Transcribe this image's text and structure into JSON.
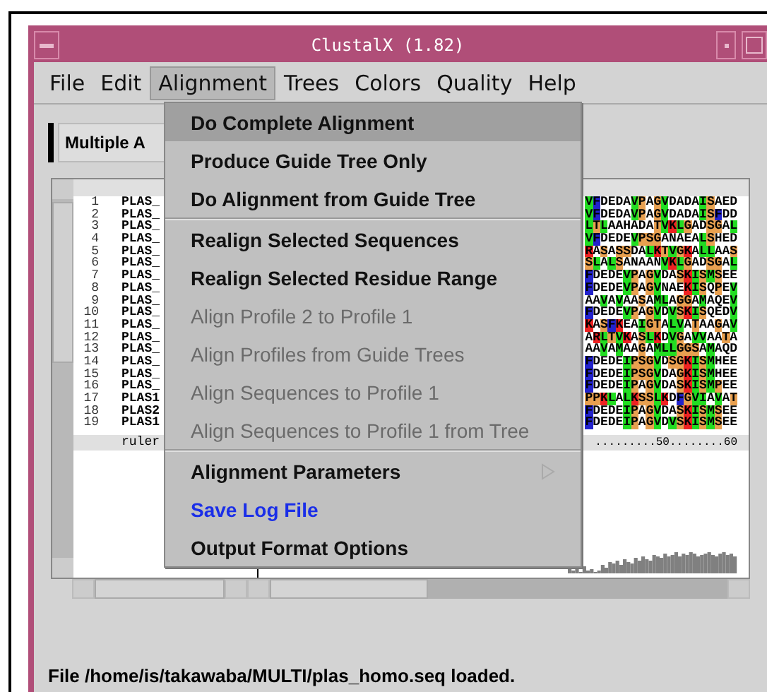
{
  "window": {
    "title": "ClustalX (1.82)"
  },
  "menubar": [
    {
      "label": "File",
      "selected": false
    },
    {
      "label": "Edit",
      "selected": false
    },
    {
      "label": "Alignment",
      "selected": true
    },
    {
      "label": "Trees",
      "selected": false
    },
    {
      "label": "Colors",
      "selected": false
    },
    {
      "label": "Quality",
      "selected": false
    },
    {
      "label": "Help",
      "selected": false
    }
  ],
  "mode_selector": {
    "label": "Multiple A"
  },
  "alignment": {
    "rows": [
      {
        "number": "1",
        "name": "PLAS_",
        "residues": "VFDEDAVPAGVDADAISAED"
      },
      {
        "number": "2",
        "name": "PLAS_",
        "residues": "VFDEDAVPAGVDADAISFDD"
      },
      {
        "number": "3",
        "name": "PLAS_",
        "residues": "LTLAAHADATVKLGADSGAL"
      },
      {
        "number": "4",
        "name": "PLAS_",
        "residues": "VFDEDEVPSGANAEALSHED"
      },
      {
        "number": "5",
        "name": "PLAS_",
        "residues": "RASASSDALKTVGKALLAAS"
      },
      {
        "number": "6",
        "name": "PLAS_",
        "residues": "SLALSANAANVKLGADSGAL"
      },
      {
        "number": "7",
        "name": "PLAS_",
        "residues": "FDEDEVPAGVDASKISMSEE"
      },
      {
        "number": "8",
        "name": "PLAS_",
        "residues": "FDEDEVPAGVNAEKISQPEV"
      },
      {
        "number": "9",
        "name": "PLAS_",
        "residues": "AAVAVAASAMLAGGAMAQEV"
      },
      {
        "number": "10",
        "name": "PLAS_",
        "residues": "FDEDEVPAGVDVSKISQEDV"
      },
      {
        "number": "11",
        "name": "PLAS_",
        "residues": "KASFKEAIGTALVATAAGAV"
      },
      {
        "number": "12",
        "name": "PLAS_",
        "residues": "ARLTVKASLKDVGAVVAATA"
      },
      {
        "number": "13",
        "name": "PLAS_",
        "residues": "AAVAMAAGAMLLGGSAMAQD"
      },
      {
        "number": "14",
        "name": "PLAS_",
        "residues": "FDEDEIPSGVDSGKISMHEE"
      },
      {
        "number": "15",
        "name": "PLAS_",
        "residues": "FDEDEIPSGVDAGKISMHEE"
      },
      {
        "number": "16",
        "name": "PLAS_",
        "residues": "FDEDEIPAGVDASKISMPEE"
      },
      {
        "number": "17",
        "name": "PLAS1",
        "residues": "PPKLALKSSLKDFGVIAVAT"
      },
      {
        "number": "18",
        "name": "PLAS2",
        "residues": "FDEDEIPAGVDASKISMSEE"
      },
      {
        "number": "19",
        "name": "PLAS1",
        "residues": "FDEDEIPAGVDVSKISMSEE"
      }
    ],
    "ruler_label": "ruler",
    "ruler": ".........50........60"
  },
  "menu": {
    "items": [
      {
        "kind": "item",
        "label": "Do Complete Alignment",
        "selected": true,
        "disabled": false,
        "submenu": false
      },
      {
        "kind": "item",
        "label": "Produce Guide Tree Only",
        "selected": false,
        "disabled": false,
        "submenu": false
      },
      {
        "kind": "item",
        "label": "Do Alignment from Guide Tree",
        "selected": false,
        "disabled": false,
        "submenu": false
      },
      {
        "kind": "separator"
      },
      {
        "kind": "item",
        "label": "Realign Selected Sequences",
        "selected": false,
        "disabled": false,
        "submenu": false
      },
      {
        "kind": "item",
        "label": "Realign Selected Residue Range",
        "selected": false,
        "disabled": false,
        "submenu": false
      },
      {
        "kind": "item",
        "label": "Align Profile 2 to Profile 1",
        "selected": false,
        "disabled": true,
        "submenu": false
      },
      {
        "kind": "item",
        "label": "Align Profiles from Guide Trees",
        "selected": false,
        "disabled": true,
        "submenu": false
      },
      {
        "kind": "item",
        "label": "Align Sequences to Profile 1",
        "selected": false,
        "disabled": true,
        "submenu": false
      },
      {
        "kind": "item",
        "label": "Align Sequences to Profile 1 from Tree",
        "selected": false,
        "disabled": true,
        "submenu": false
      },
      {
        "kind": "separator"
      },
      {
        "kind": "item",
        "label": "Alignment Parameters",
        "selected": false,
        "disabled": false,
        "submenu": true
      },
      {
        "kind": "accent",
        "label": "Save Log File",
        "selected": false,
        "disabled": false,
        "submenu": false
      },
      {
        "kind": "item",
        "label": "Output Format Options",
        "selected": false,
        "disabled": false,
        "submenu": false
      }
    ]
  },
  "status_bar": "File /home/is/takawaba/MULTI/plas_homo.seq loaded."
}
